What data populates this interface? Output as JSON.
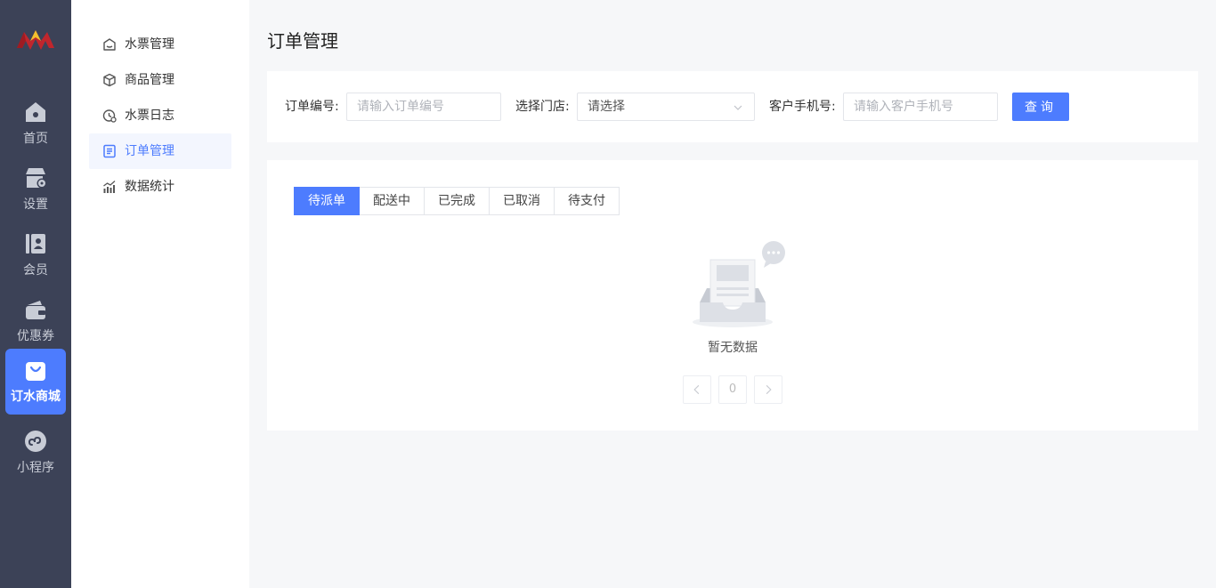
{
  "rail": {
    "items": [
      {
        "label": "首页",
        "icon": "home-icon"
      },
      {
        "label": "设置",
        "icon": "store-settings-icon"
      },
      {
        "label": "会员",
        "icon": "member-card-icon"
      },
      {
        "label": "优惠券",
        "icon": "wallet-icon"
      },
      {
        "label": "订水商城",
        "icon": "shopping-bag-icon",
        "active": true
      },
      {
        "label": "小程序",
        "icon": "mini-program-icon"
      }
    ]
  },
  "submenu": {
    "items": [
      {
        "label": "水票管理",
        "icon": "ticket-icon"
      },
      {
        "label": "商品管理",
        "icon": "box-icon"
      },
      {
        "label": "水票日志",
        "icon": "clock-log-icon"
      },
      {
        "label": "订单管理",
        "icon": "order-list-icon",
        "active": true
      },
      {
        "label": "数据统计",
        "icon": "chart-icon"
      }
    ]
  },
  "page": {
    "title": "订单管理"
  },
  "filters": {
    "order_no_label": "订单编号:",
    "order_no_placeholder": "请输入订单编号",
    "store_label": "选择门店:",
    "store_value": "请选择",
    "phone_label": "客户手机号:",
    "phone_placeholder": "请输入客户手机号",
    "query_label": "查询"
  },
  "tabs": [
    {
      "label": "待派单",
      "active": true
    },
    {
      "label": "配送中"
    },
    {
      "label": "已完成"
    },
    {
      "label": "已取消"
    },
    {
      "label": "待支付"
    }
  ],
  "empty": {
    "text": "暂无数据"
  },
  "pager": {
    "current": "0"
  },
  "colors": {
    "rail_bg": "#3c4257",
    "accent": "#4d7cfe",
    "page_bg": "#f6f7f9"
  }
}
